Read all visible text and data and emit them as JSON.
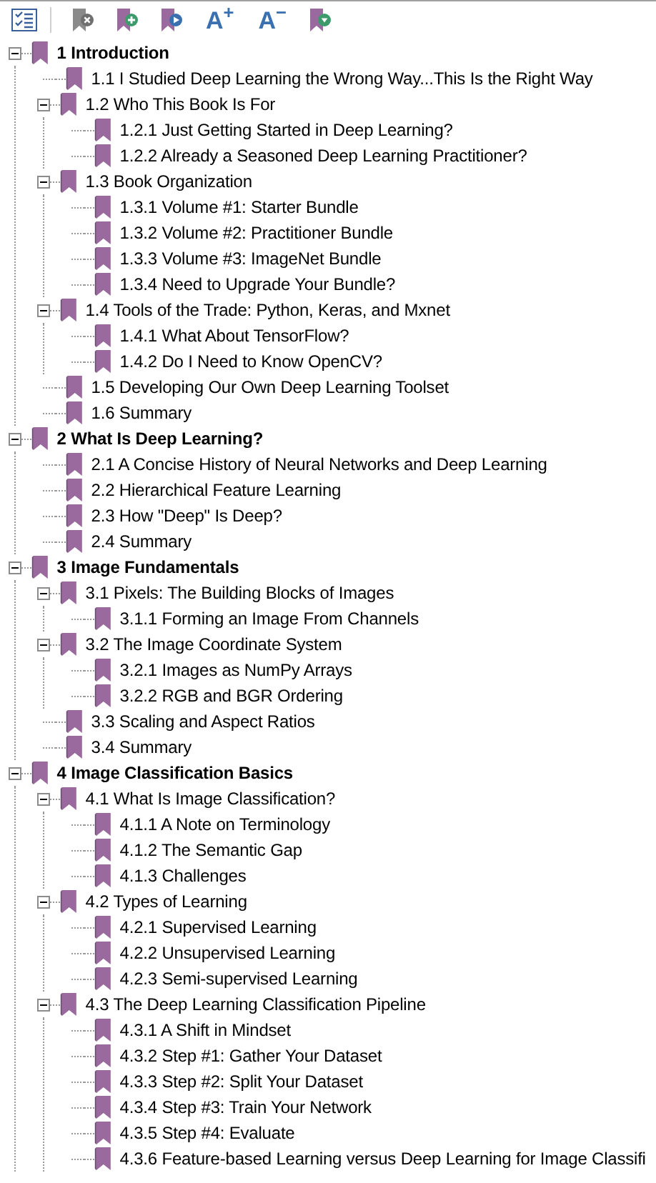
{
  "toolbar": [
    {
      "kind": "checklist"
    },
    {
      "kind": "bookmark-delete"
    },
    {
      "kind": "bookmark-add"
    },
    {
      "kind": "bookmark-goto"
    },
    {
      "kind": "font",
      "label": "A$^{+}$"
    },
    {
      "kind": "font",
      "label": "A$^{−}$"
    },
    {
      "kind": "bookmark-down"
    }
  ],
  "tree": [
    {
      "title": "1 Introduction",
      "expanded": true,
      "children": [
        {
          "title": "1.1 I Studied Deep Learning the Wrong Way...This Is the Right Way"
        },
        {
          "title": "1.2 Who This Book Is For",
          "expanded": true,
          "children": [
            {
              "title": "1.2.1 Just Getting Started in Deep Learning?"
            },
            {
              "title": "1.2.2 Already a Seasoned Deep Learning Practitioner?"
            }
          ]
        },
        {
          "title": "1.3 Book Organization",
          "expanded": true,
          "children": [
            {
              "title": "1.3.1 Volume #1: Starter Bundle"
            },
            {
              "title": "1.3.2 Volume #2: Practitioner Bundle"
            },
            {
              "title": "1.3.3 Volume #3: ImageNet Bundle"
            },
            {
              "title": "1.3.4 Need to Upgrade Your Bundle?"
            }
          ]
        },
        {
          "title": "1.4 Tools of the Trade: Python, Keras, and Mxnet",
          "expanded": true,
          "children": [
            {
              "title": "1.4.1 What About TensorFlow?"
            },
            {
              "title": "1.4.2 Do I Need to Know OpenCV?"
            }
          ]
        },
        {
          "title": "1.5 Developing Our Own Deep Learning Toolset"
        },
        {
          "title": "1.6 Summary"
        }
      ]
    },
    {
      "title": "2 What Is Deep Learning?",
      "expanded": true,
      "children": [
        {
          "title": "2.1 A Concise History of Neural Networks and Deep Learning"
        },
        {
          "title": "2.2 Hierarchical Feature Learning"
        },
        {
          "title": "2.3 How \"Deep\" Is Deep?"
        },
        {
          "title": "2.4 Summary"
        }
      ]
    },
    {
      "title": "3 Image Fundamentals",
      "expanded": true,
      "children": [
        {
          "title": "3.1 Pixels: The Building Blocks of Images",
          "expanded": true,
          "children": [
            {
              "title": "3.1.1 Forming an Image From Channels"
            }
          ]
        },
        {
          "title": "3.2 The Image Coordinate System",
          "expanded": true,
          "children": [
            {
              "title": "3.2.1 Images as NumPy Arrays"
            },
            {
              "title": "3.2.2 RGB and BGR Ordering"
            }
          ]
        },
        {
          "title": "3.3 Scaling and Aspect Ratios"
        },
        {
          "title": "3.4 Summary"
        }
      ]
    },
    {
      "title": "4 Image Classification Basics",
      "expanded": true,
      "children": [
        {
          "title": "4.1 What Is Image Classification?",
          "expanded": true,
          "children": [
            {
              "title": "4.1.1 A Note on Terminology"
            },
            {
              "title": "4.1.2 The Semantic Gap"
            },
            {
              "title": "4.1.3 Challenges"
            }
          ]
        },
        {
          "title": "4.2 Types of Learning",
          "expanded": true,
          "children": [
            {
              "title": "4.2.1 Supervised Learning"
            },
            {
              "title": "4.2.2 Unsupervised Learning"
            },
            {
              "title": "4.2.3 Semi-supervised Learning"
            }
          ]
        },
        {
          "title": "4.3 The Deep Learning Classification Pipeline",
          "expanded": true,
          "children": [
            {
              "title": "4.3.1 A Shift in Mindset"
            },
            {
              "title": "4.3.2 Step #1: Gather Your Dataset"
            },
            {
              "title": "4.3.3 Step #2: Split Your Dataset"
            },
            {
              "title": "4.3.4 Step #3: Train Your Network"
            },
            {
              "title": "4.3.5 Step #4: Evaluate"
            },
            {
              "title": "4.3.6 Feature-based Learning versus Deep Learning for Image Classifi"
            }
          ]
        }
      ]
    }
  ]
}
